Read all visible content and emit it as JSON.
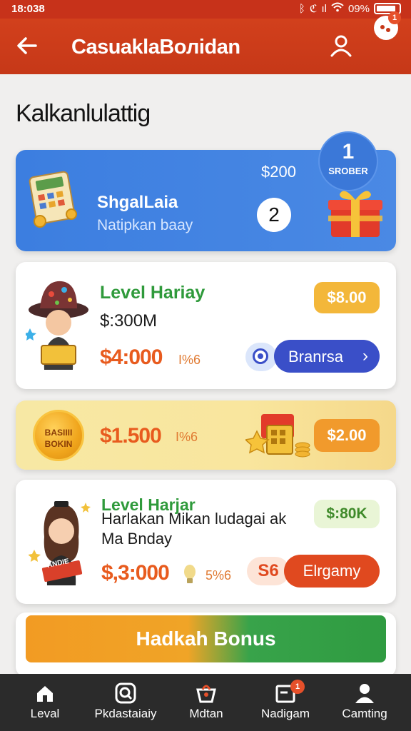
{
  "status_bar": {
    "time": "18:038",
    "battery_text": "09%"
  },
  "app_bar": {
    "title": "CasuaklaBoлidan",
    "notification_count": "1"
  },
  "section": {
    "title": "Kalkanlulattig"
  },
  "card_blue": {
    "badge_number": "1",
    "badge_text": "SROBER",
    "amount": "$200",
    "title": "ShgalLaia",
    "subtitle": "Natipkan baay",
    "count": "2"
  },
  "card_level1": {
    "title": "Level Hariay",
    "sub": "$:300M",
    "amount": "$4:000",
    "unit": "I%6",
    "pill": "$8.00",
    "button_label": "Branrsa",
    "button_chevron": "›"
  },
  "card_coin": {
    "coin_line1": "BASIIII",
    "coin_line2": "BOKIN",
    "amount": "$1.500",
    "unit": "I%6",
    "pill": "$2.00"
  },
  "card_level2": {
    "title": "Level Harjar",
    "line1": "Harlakan Mikan ludagai ak",
    "line2": "Ma Bnday",
    "amount": "$,3:000",
    "unit": "5%6",
    "pill": "$:80K",
    "ring_label": "S6",
    "button_label": "Elrgamy",
    "sticker": "ANDIE"
  },
  "big_button": {
    "label": "Hadkah Bonus"
  },
  "bottom_nav": {
    "items": [
      {
        "label": "Leval",
        "icon": "home-icon"
      },
      {
        "label": "Pkdastaiaiy",
        "icon": "search-icon"
      },
      {
        "label": "Mdtan",
        "icon": "basket-icon"
      },
      {
        "label": "Nadigam",
        "icon": "inbox-icon",
        "badge": "1"
      },
      {
        "label": "Camting",
        "icon": "person-icon"
      }
    ]
  },
  "colors": {
    "app_bar": "#c63818",
    "blue_card": "#3c7ee0",
    "accent_orange": "#e85b1e",
    "accent_green": "#2f9a3b"
  }
}
